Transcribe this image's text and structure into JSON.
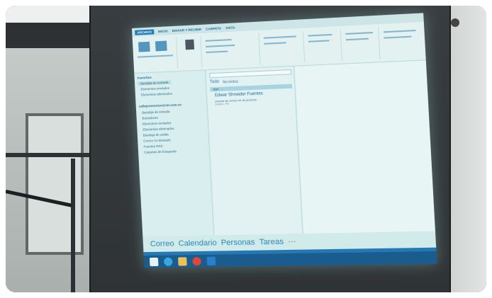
{
  "ribbon_tabs": [
    "ARCHIVO",
    "INICIO",
    "ENVIAR Y RECIBIR",
    "CARPETA",
    "VISTA"
  ],
  "folders": {
    "favorites_header": "Favoritos",
    "favorites": [
      "Bandeja de entrada",
      "Elementos enviados",
      "Elementos eliminados"
    ],
    "account": "callepromocion@vtr.com.co",
    "account_folders": [
      "Bandeja de entrada",
      "Borradores",
      "Elementos enviados",
      "Elementos eliminados",
      "Bandeja de salida",
      "Correo no deseado",
      "Fuentes RSS",
      "Carpetas de búsqueda"
    ]
  },
  "mail_list": {
    "filter_all": "Todo",
    "filter_unread": "No leídos",
    "group_today": "Ayer",
    "message": {
      "sender": "Edwar Shneider Fuentes",
      "subject": "prueba de correo vtr de proceso",
      "preview": "prueba - Fin"
    }
  },
  "nav_bar": [
    "Correo",
    "Calendario",
    "Personas",
    "Tareas",
    "···"
  ],
  "colors": {
    "projection_bg": "#d6ecec",
    "accent_blue": "#2b86b7",
    "taskbar": "#1b5c8f"
  },
  "taskbar_icons": [
    "windows-start-icon",
    "internet-explorer-icon",
    "file-explorer-icon",
    "chrome-icon",
    "outlook-icon"
  ]
}
